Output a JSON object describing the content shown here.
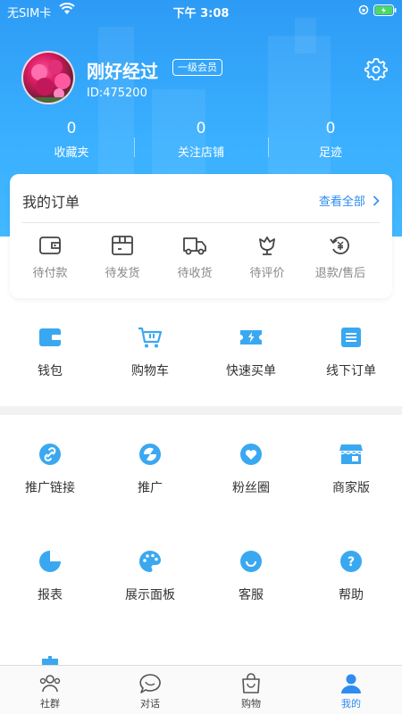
{
  "status_bar": {
    "carrier": "无SIM卡",
    "time": "下午 3:08"
  },
  "profile": {
    "name": "刚好经过",
    "level": "一级会员",
    "id": "ID:475200"
  },
  "stats": [
    {
      "value": "0",
      "label": "收藏夹"
    },
    {
      "value": "0",
      "label": "关注店铺"
    },
    {
      "value": "0",
      "label": "足迹"
    }
  ],
  "orders": {
    "title": "我的订单",
    "view_all": "查看全部",
    "items": [
      {
        "label": "待付款",
        "icon": "wallet-icon"
      },
      {
        "label": "待发货",
        "icon": "box-icon"
      },
      {
        "label": "待收货",
        "icon": "truck-icon"
      },
      {
        "label": "待评价",
        "icon": "flower-icon"
      },
      {
        "label": "退款/售后",
        "icon": "refund-icon"
      }
    ]
  },
  "quick_actions": [
    {
      "label": "钱包",
      "icon": "wallet-icon"
    },
    {
      "label": "购物车",
      "icon": "cart-icon"
    },
    {
      "label": "快速买单",
      "icon": "ticket-icon"
    },
    {
      "label": "线下订单",
      "icon": "list-icon"
    }
  ],
  "services": [
    {
      "label": "推广链接",
      "icon": "link-icon"
    },
    {
      "label": "推广",
      "icon": "promote-icon"
    },
    {
      "label": "粉丝圈",
      "icon": "heart-icon"
    },
    {
      "label": "商家版",
      "icon": "store-icon"
    },
    {
      "label": "报表",
      "icon": "pie-chart-icon"
    },
    {
      "label": "展示面板",
      "icon": "palette-icon"
    },
    {
      "label": "客服",
      "icon": "chat-smile-icon"
    },
    {
      "label": "帮助",
      "icon": "help-icon"
    }
  ],
  "tabbar": [
    {
      "label": "社群",
      "icon": "community-icon",
      "active": false
    },
    {
      "label": "对话",
      "icon": "chat-icon",
      "active": false
    },
    {
      "label": "购物",
      "icon": "shopping-bag-icon",
      "active": false
    },
    {
      "label": "我的",
      "icon": "user-icon",
      "active": true
    }
  ],
  "colors": {
    "primary": "#2d9bf5",
    "accent": "#2d8cf0",
    "icon_blue": "#3aa8f0"
  }
}
